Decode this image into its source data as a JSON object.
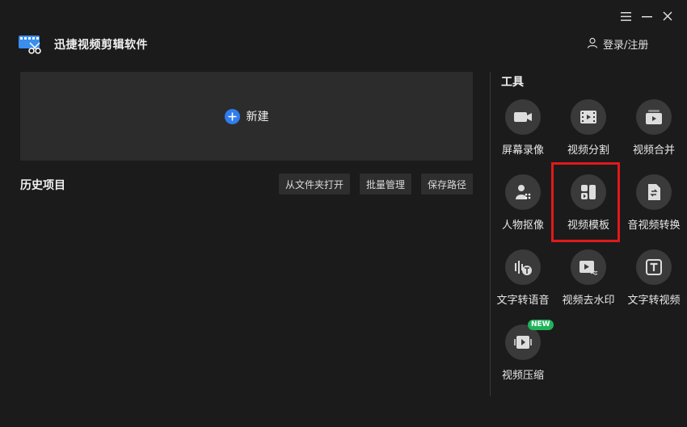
{
  "app": {
    "title": "迅捷视频剪辑软件",
    "login_label": "登录/注册"
  },
  "new_project": {
    "label": "新建",
    "accent": "#2f7dee"
  },
  "history": {
    "title": "历史项目",
    "actions": [
      "从文件夹打开",
      "批量管理",
      "保存路径"
    ]
  },
  "tools": {
    "title": "工具",
    "items": [
      {
        "label": "屏幕录像",
        "icon": "camera-icon"
      },
      {
        "label": "视频分割",
        "icon": "film-split-icon"
      },
      {
        "label": "视频合并",
        "icon": "video-merge-icon"
      },
      {
        "label": "人物抠像",
        "icon": "person-cutout-icon"
      },
      {
        "label": "视频模板",
        "icon": "template-icon"
      },
      {
        "label": "音视频转换",
        "icon": "convert-icon"
      },
      {
        "label": "文字转语音",
        "icon": "text-to-speech-icon"
      },
      {
        "label": "视频去水印",
        "icon": "remove-watermark-icon"
      },
      {
        "label": "文字转视频",
        "icon": "text-to-video-icon"
      },
      {
        "label": "视频压缩",
        "icon": "compress-icon",
        "badge": "NEW"
      }
    ],
    "highlight_color": "#e0191b",
    "badge_color": "#1fb35a"
  }
}
